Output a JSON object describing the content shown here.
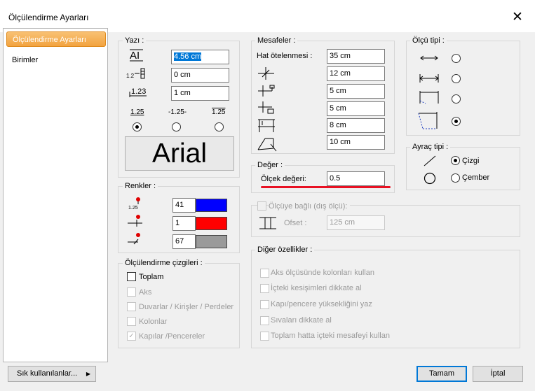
{
  "window": {
    "title": "Ölçülendirme Ayarları",
    "close_glyph": "✕"
  },
  "sidebar": {
    "items": [
      {
        "label": "Ölçülendirme Ayarları"
      },
      {
        "label": "Birimler"
      }
    ]
  },
  "yazi": {
    "legend": "Yazı :",
    "fields": [
      "4.56 cm",
      "0 cm",
      "1 cm"
    ],
    "align_labels": [
      "1.25",
      "-1.25-",
      "1.25"
    ],
    "selected_align": 0,
    "font_name": "Arial"
  },
  "renkler": {
    "legend": "Renkler :",
    "rows": [
      {
        "value": "41",
        "color": "#0000ff"
      },
      {
        "value": "1",
        "color": "#ff0000"
      },
      {
        "value": "67",
        "color": "#9a9a9a"
      }
    ]
  },
  "cizgiler": {
    "legend": "Ölçülendirme çizgileri :",
    "items": [
      {
        "label": "Toplam",
        "checked": false,
        "enabled": true
      },
      {
        "label": "Aks",
        "checked": false,
        "enabled": false
      },
      {
        "label": "Duvarlar / Kirişler / Perdeler",
        "checked": false,
        "enabled": false
      },
      {
        "label": "Kolonlar",
        "checked": false,
        "enabled": false
      },
      {
        "label": "Kapılar /Pencereler",
        "checked": true,
        "enabled": false
      }
    ]
  },
  "mesafeler": {
    "legend": "Mesafeler :",
    "hat_label": "Hat ötelenmesi :",
    "values": [
      "35 cm",
      "12 cm",
      "5 cm",
      "5 cm",
      "8 cm",
      "10 cm"
    ]
  },
  "deger": {
    "legend": "Değer :",
    "label": "Ölçek değeri:",
    "value": "0.5"
  },
  "olcuye_bagli": {
    "label": "Ölçüye bağlı (dış ölçü):",
    "ofset_label": "Ofset :",
    "ofset_value": "125 cm"
  },
  "diger": {
    "legend": "Diğer özellikler :",
    "items": [
      "Aks ölçüsünde kolonları kullan",
      "İçteki kesişimleri dikkate al",
      "Kapı/pencere yüksekliğini yaz",
      "Sıvaları dikkate al",
      "Toplam hatta içteki mesafeyi kullan"
    ]
  },
  "olcu_tipi": {
    "legend": "Ölçü tipi :",
    "selected": 3
  },
  "ayrac_tipi": {
    "legend": "Ayraç tipi :",
    "options": [
      "Çizgi",
      "Çember"
    ],
    "selected": 0
  },
  "footer": {
    "frequent": "Sık kullanılanlar...",
    "ok": "Tamam",
    "cancel": "İptal"
  }
}
